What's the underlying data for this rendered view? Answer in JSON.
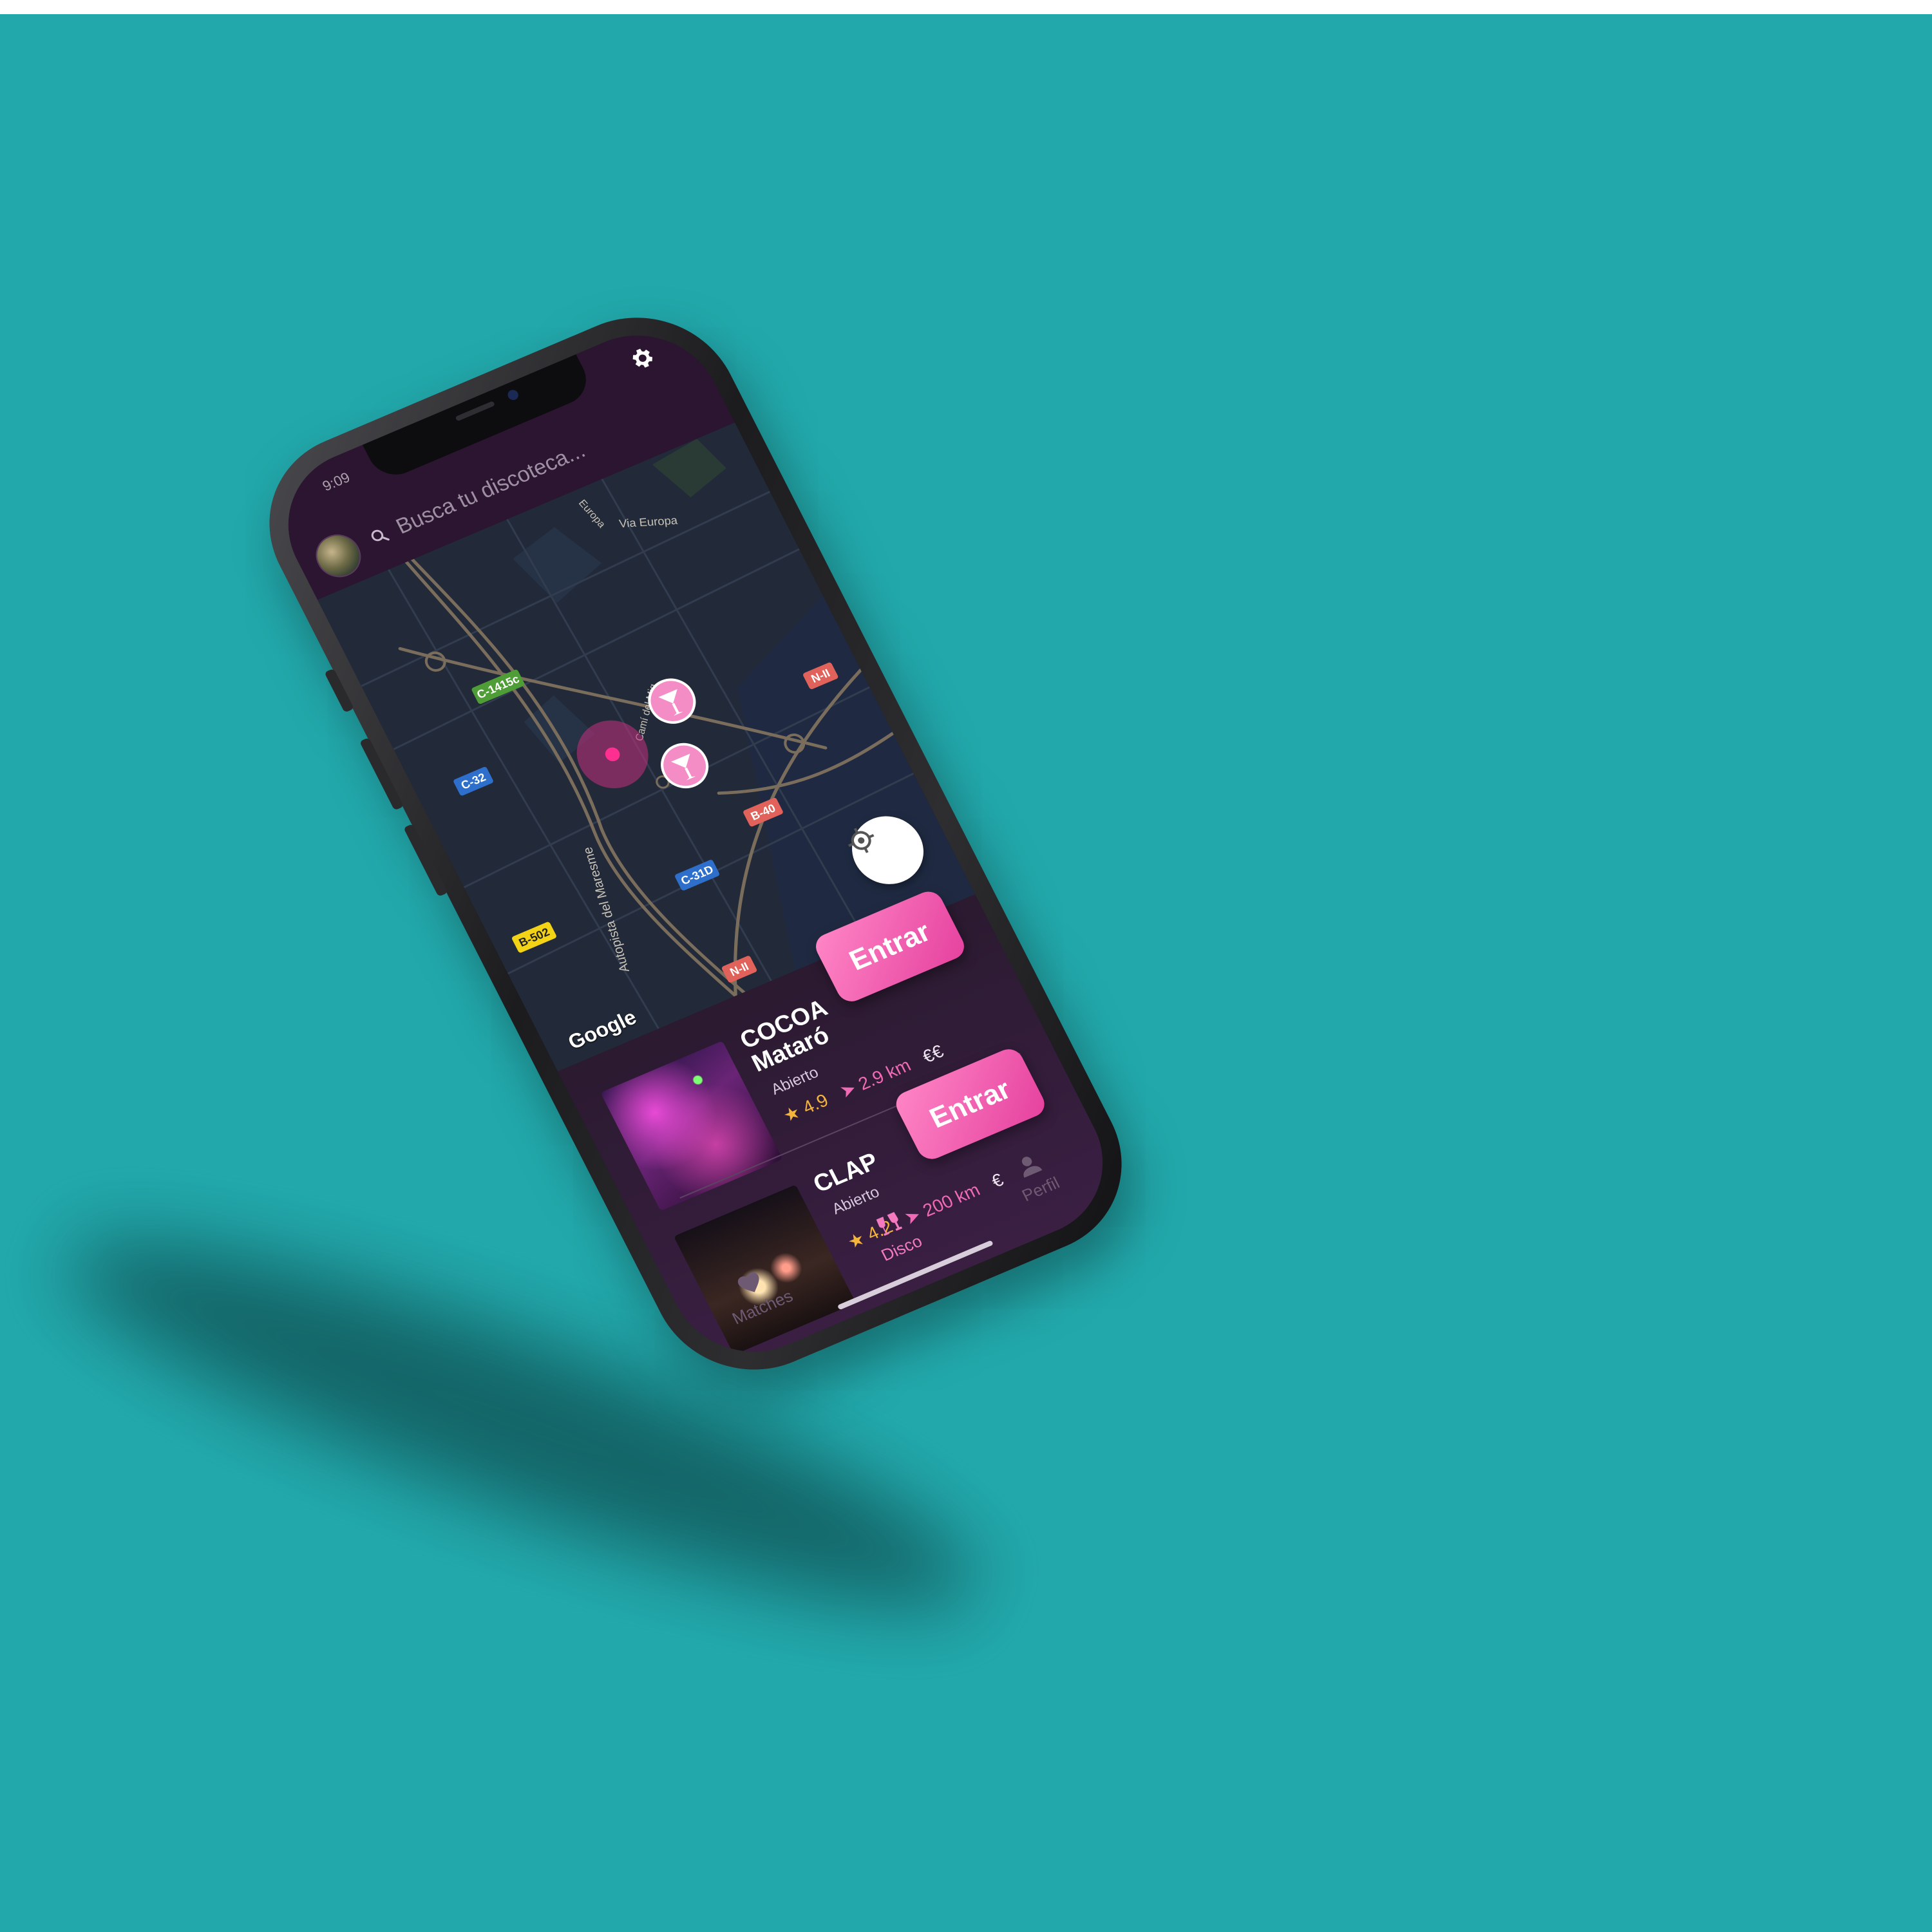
{
  "status": {
    "time": "9:09"
  },
  "header": {
    "search_placeholder": "Busca tu discoteca..."
  },
  "map": {
    "attribution": "Google",
    "road_labels": [
      "C-1415c",
      "C-32",
      "B-502",
      "C-31D",
      "B-40",
      "N-II",
      "N-II"
    ],
    "street_labels": [
      "Autopista del Maresme",
      "Via Europa",
      "Europa",
      "Camí del Mig"
    ],
    "markers": [
      "current-location",
      "disco",
      "disco"
    ]
  },
  "venues": [
    {
      "name": "COCOA Mataró",
      "status": "Abierto",
      "rating": "4.9",
      "distance": "2.9 km",
      "price": "€€",
      "button": "Entrar"
    },
    {
      "name": "CLAP",
      "status": "Abierto",
      "rating": "4.2",
      "distance": "200 km",
      "price": "€",
      "button": "Entrar"
    }
  ],
  "tabs": [
    {
      "label": "Matches",
      "icon": "heart-icon",
      "active": false
    },
    {
      "label": "Disco",
      "icon": "cheers-icon",
      "active": true
    },
    {
      "label": "Perfil",
      "icon": "user-icon",
      "active": false
    }
  ],
  "colors": {
    "background": "#22a8ab",
    "header": "#2c1530",
    "accent": "#e5419e",
    "map": "#222a39"
  }
}
